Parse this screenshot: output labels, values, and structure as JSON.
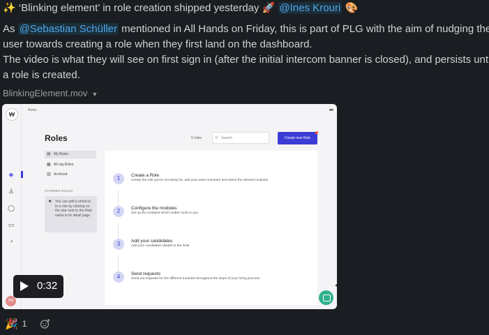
{
  "message": {
    "line1": {
      "prefix_emoji": "✨",
      "text": "‘Blinking element’ in role creation shipped yesterday",
      "emoji_rocket": "🚀",
      "mention": "@Ines Krouri",
      "emoji_palette": "🎨"
    },
    "line2": {
      "prefix": "As ",
      "mention": "@Sebastian Schüller",
      "text": " mentioned in All Hands on Friday, this is part of PLG with the aim of nudging the"
    },
    "line3": "user towards creating a role when they first land on the dashboard.",
    "line4": "The video is what they will see on first sign in (after the initial intercom banner is closed), and persists until",
    "line5": "a role is created."
  },
  "attachment": {
    "filename": "BlinkingElement.mov",
    "duration": "0:32",
    "preview": {
      "breadcrumb": "Roles",
      "title": "Roles",
      "role_count": "0 roles",
      "search_placeholder": "Search",
      "create_button": "Create new Role",
      "sidebar": [
        "My Roles",
        "All org Roles",
        "Archived"
      ],
      "starred_heading": "STARRED ROLES",
      "starred_tip": "You can add a shortcut to a role by clicking on the star next to the Role name in its detail page.",
      "avatar_initials": "HN",
      "steps": [
        {
          "num": "1",
          "title": "Create a Role",
          "desc": "Create the role you're recruiting for, add your team members and select the desired modules"
        },
        {
          "num": "2",
          "title": "Configure the modules",
          "desc": "Set up the modules which matter most to you"
        },
        {
          "num": "3",
          "title": "Add your candidates",
          "desc": "Add your candidates details to the Role"
        },
        {
          "num": "4",
          "title": "Send requests",
          "desc": "Send out requests for the different modules throughout the steps of your hiring process"
        }
      ]
    }
  },
  "reactions": {
    "party_emoji": "🎉",
    "party_count": "1"
  }
}
